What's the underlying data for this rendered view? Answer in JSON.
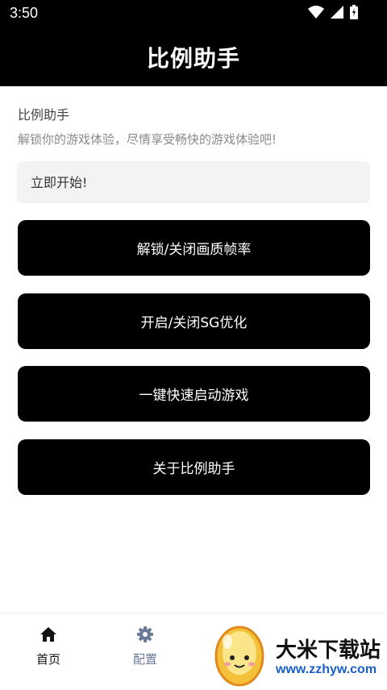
{
  "status_bar": {
    "time": "3:50"
  },
  "app_bar": {
    "title": "比例助手"
  },
  "intro": {
    "heading": "比例助手",
    "subtitle": "解锁你的游戏体验，尽情享受畅快的游戏体验吧!",
    "start_text": "立即开始!"
  },
  "actions": [
    {
      "label": "解锁/关闭画质帧率"
    },
    {
      "label": "开启/关闭SG优化"
    },
    {
      "label": "一键快速启动游戏"
    },
    {
      "label": "关于比例助手"
    }
  ],
  "bottom_nav": {
    "items": [
      {
        "label": "首页",
        "icon": "home-icon",
        "active": true
      },
      {
        "label": "配置",
        "icon": "gear-icon",
        "active": false
      }
    ],
    "active_color": "#111111",
    "inactive_color": "#6b7a99"
  },
  "watermark": {
    "title": "大米下载站",
    "url": "www.zzhyw.com"
  }
}
